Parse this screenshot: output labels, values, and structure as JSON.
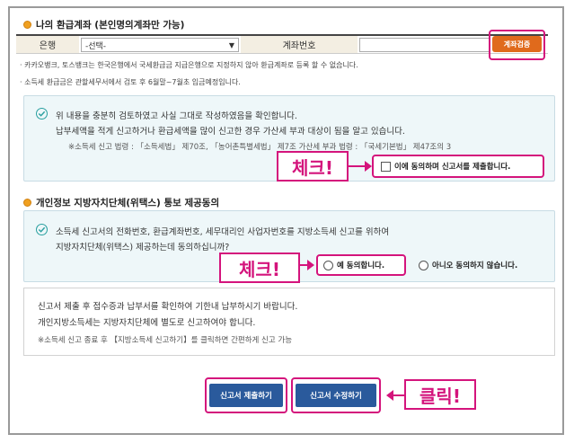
{
  "refund": {
    "title": "나의 환급계좌 (본인명의계좌만 가능)",
    "bank_label": "은행",
    "bank_select": "-선택-",
    "account_label": "계좌번호",
    "verify_button": "계좌검증",
    "note1": "· 카카오뱅크, 토스뱅크는 한국은행에서 국세환급금 지급은행으로 지정하지 않아 환급계좌로 등록 할 수 없습니다.",
    "note2": "· 소득세 환급금은 관할세무서에서 검토 후 6월말~7월초 입금예정입니다."
  },
  "confirm": {
    "line1": "위 내용을 충분히 검토하였고 사실 그대로 작성하였음을 확인합니다.",
    "line2": "납부세액을 적게 신고하거나 환급세액을 많이 신고한 경우 가산세 부과 대상이 됨을 알고 있습니다.",
    "law": "※소득세 신고 법령 : 「소득세법」 제70조, 「농어촌특별세법」 제7조 가산세 부과 법령 : 「국세기본법」 제47조의 3",
    "agree_checkbox": "이에 동의하며 신고서를 제출합니다."
  },
  "privacy": {
    "title": "개인정보 지방자치단체(위택스) 통보 제공동의",
    "line1": "소득세 신고서의 전화번호, 환급계좌번호, 세무대리인 사업자번호를 지방소득세 신고를 위하여",
    "line2": "지방자치단체(위택스) 제공하는데 동의하십니까?",
    "radio_yes": "예 동의합니다.",
    "radio_no": "아니오 동의하지 않습니다."
  },
  "info": {
    "line1": "신고서 제출 후 접수증과 납부서를 확인하여 기한내 납부하시기 바랍니다.",
    "line2": "개인지방소득세는 지방자치단체에 별도로 신고하여야 합니다.",
    "line3": "※소득세 신고 종료 후 【지방소득세 신고하기】를 클릭하면 간편하게 신고 가능"
  },
  "buttons": {
    "submit": "신고서 제출하기",
    "edit": "신고서 수정하기"
  },
  "callouts": {
    "check1": "체크!",
    "check2": "체크!",
    "click": "클릭!"
  },
  "colors": {
    "highlight": "#d4147c",
    "button_blue": "#2a5a9c",
    "button_orange": "#e06a1c"
  }
}
